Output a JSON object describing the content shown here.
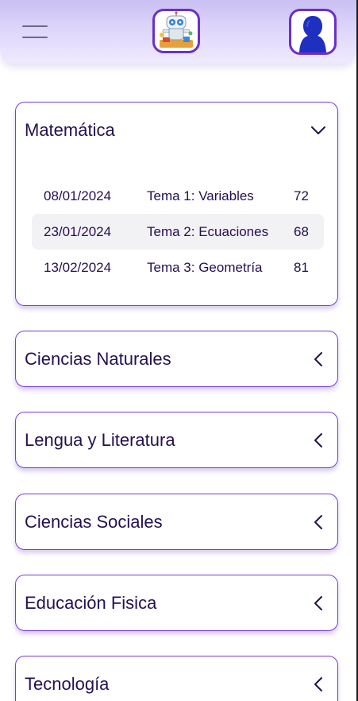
{
  "header": {
    "menu_icon": "hamburger-menu-icon",
    "logo_icon": "robot-mascot-logo",
    "avatar_icon": "user-avatar-icon"
  },
  "colors": {
    "accent": "#7a3bdc",
    "header_top": "#c9bff2",
    "header_bottom": "#efeafd",
    "text": "#241050",
    "row_highlight": "#f2f1f4"
  },
  "subjects": [
    {
      "name": "Matemática",
      "expanded": true,
      "chevron_icon": "chevron-down-icon",
      "grades": [
        {
          "date": "08/01/2024",
          "topic": "Tema 1: Variables",
          "score": "72"
        },
        {
          "date": "23/01/2024",
          "topic": "Tema 2: Ecuaciones",
          "score": "68"
        },
        {
          "date": "13/02/2024",
          "topic": "Tema 3: Geometría",
          "score": "81"
        }
      ]
    },
    {
      "name": "Ciencias Naturales",
      "expanded": false,
      "chevron_icon": "chevron-left-icon"
    },
    {
      "name": "Lengua y Literatura",
      "expanded": false,
      "chevron_icon": "chevron-left-icon"
    },
    {
      "name": "Ciencias Sociales",
      "expanded": false,
      "chevron_icon": "chevron-left-icon"
    },
    {
      "name": "Educación Fisica",
      "expanded": false,
      "chevron_icon": "chevron-left-icon"
    },
    {
      "name": "Tecnología",
      "expanded": false,
      "chevron_icon": "chevron-left-icon"
    }
  ]
}
